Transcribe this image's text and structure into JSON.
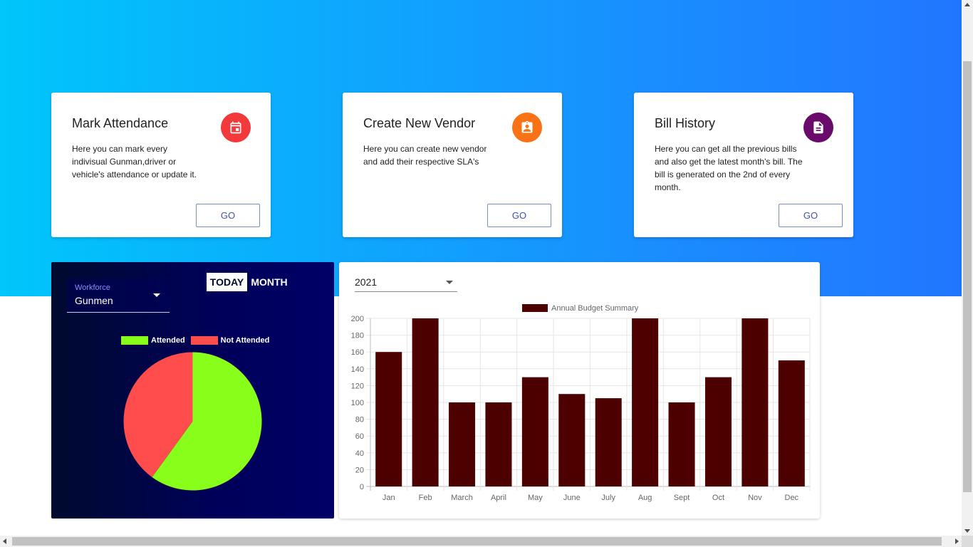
{
  "cards": [
    {
      "title": "Mark Attendance",
      "text": "Here you can mark every indivisual Gunman,driver or vehicle's attendance or update it.",
      "button": "GO",
      "icon": "calendar-icon",
      "icon_color": "#f23a3a"
    },
    {
      "title": "Create New Vendor",
      "text": "Here you can create new vendor and add their respective SLA's",
      "button": "GO",
      "icon": "contact-badge-icon",
      "icon_color": "#f97316"
    },
    {
      "title": "Bill History",
      "text": "Here you can get all the previous bills and also get the latest month's bill. The bill is generated on the 2nd of every month.",
      "button": "GO",
      "icon": "document-icon",
      "icon_color": "#6a0a6a"
    }
  ],
  "attendance": {
    "select_label": "Workforce",
    "select_value": "Gunmen",
    "toggle_today": "TODAY",
    "toggle_month": "MONTH"
  },
  "budget": {
    "year_value": "2021"
  },
  "chart_data": [
    {
      "type": "pie",
      "labels": [
        "Attended",
        "Not Attended"
      ],
      "values": [
        60,
        40
      ],
      "colors": [
        "#88ff1a",
        "#ff4c4c"
      ],
      "legend_position": "top"
    },
    {
      "type": "bar",
      "categories": [
        "Jan",
        "Feb",
        "March",
        "April",
        "May",
        "June",
        "July",
        "Aug",
        "Sept",
        "Oct",
        "Nov",
        "Dec"
      ],
      "series": [
        {
          "name": "Annual Budget Summary",
          "values": [
            160,
            200,
            100,
            100,
            130,
            110,
            105,
            200,
            100,
            130,
            200,
            150
          ],
          "color": "#4d0000"
        }
      ],
      "ylim": [
        0,
        200
      ],
      "yticks": [
        0,
        20,
        40,
        60,
        80,
        100,
        120,
        140,
        160,
        180,
        200
      ],
      "grid": true,
      "legend_position": "top"
    }
  ]
}
